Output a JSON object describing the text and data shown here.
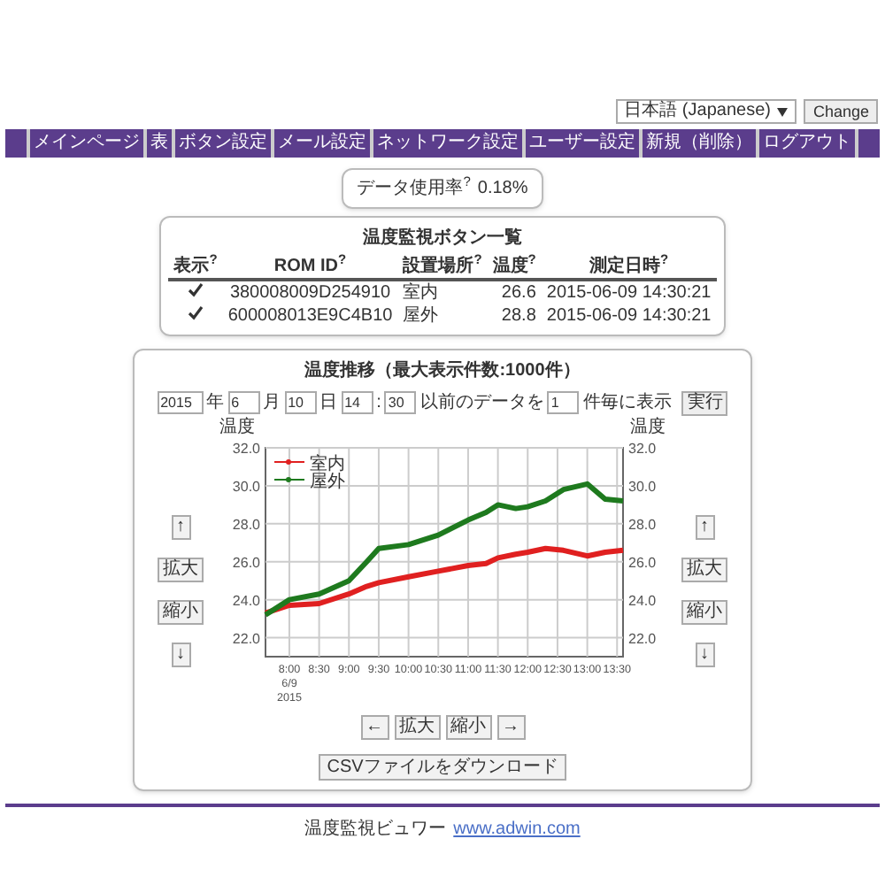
{
  "language": {
    "value": "日本語 (Japanese)",
    "button": "Change"
  },
  "nav": [
    "メインページ",
    "表",
    "ボタン設定",
    "メール設定",
    "ネットワーク設定",
    "ユーザー設定",
    "新規（削除）",
    "ログアウト"
  ],
  "usage": {
    "label": "データ使用率$^{?}$",
    "value": "0.18%"
  },
  "sensor_table": {
    "title": "温度監視ボタン一覧",
    "columns": [
      "表示$^{?}$",
      "ROM ID$^{?}$",
      "設置場所$^{?}$",
      "温度$^{?}$",
      "測定日時$^{?}$"
    ],
    "rows": [
      {
        "checked": true,
        "rom_id": "380008009D254910",
        "place": "室内",
        "temp": "26.6",
        "time": "2015-06-09 14:30:21"
      },
      {
        "checked": true,
        "rom_id": "600008013E9C4B10",
        "place": "屋外",
        "temp": "28.8",
        "time": "2015-06-09 14:30:21"
      }
    ]
  },
  "chart_panel": {
    "title": "温度推移（最大表示件数:1000件）",
    "form": [
      {
        "kind": "input",
        "value": "2015"
      },
      {
        "kind": "text",
        "text": "年"
      },
      {
        "kind": "input",
        "value": "6"
      },
      {
        "kind": "text",
        "text": "月"
      },
      {
        "kind": "input",
        "value": "10"
      },
      {
        "kind": "text",
        "text": "日"
      },
      {
        "kind": "input",
        "value": "14"
      },
      {
        "kind": "text",
        "text": ":"
      },
      {
        "kind": "input",
        "value": "30"
      },
      {
        "kind": "text",
        "text": "以前のデータを"
      },
      {
        "kind": "input",
        "value": "1"
      },
      {
        "kind": "text",
        "text": "件毎に表示"
      },
      {
        "kind": "button",
        "text": "実行"
      }
    ],
    "left_axis_label": "温度",
    "right_axis_label": "温度",
    "left_buttons": [
      "↑",
      "拡大",
      "縮小",
      "↓"
    ],
    "right_buttons": [
      "↑",
      "拡大",
      "縮小",
      "↓"
    ],
    "bottom_buttons": [
      "←",
      "拡大",
      "縮小",
      "→"
    ],
    "csv_button": "CSVファイルをダウンロード",
    "chart_data": {
      "type": "line",
      "x": [
        7.6,
        8,
        8.5,
        9,
        9.3,
        9.5,
        10,
        10.5,
        11,
        11.3,
        11.5,
        11.8,
        12,
        12.3,
        12.6,
        13,
        13.3,
        13.6
      ],
      "series": [
        {
          "name": "室内",
          "color": "#e02020",
          "values": [
            23.3,
            23.7,
            23.8,
            24.3,
            24.7,
            24.9,
            25.2,
            25.5,
            25.8,
            25.9,
            26.2,
            26.4,
            26.5,
            26.7,
            26.6,
            26.3,
            26.5,
            26.6
          ]
        },
        {
          "name": "屋外",
          "color": "#1e7a1e",
          "values": [
            23.2,
            24.0,
            24.3,
            25.0,
            26.0,
            26.7,
            26.9,
            27.4,
            28.2,
            28.6,
            29.0,
            28.8,
            28.9,
            29.2,
            29.8,
            30.1,
            29.3,
            29.2
          ]
        }
      ],
      "xlim": [
        7.6,
        13.6
      ],
      "ylim": [
        21,
        32
      ],
      "y2lim": [
        21,
        32
      ],
      "grid": true,
      "legend": true,
      "yticks": [
        {
          "value": 22,
          "label": "22.0"
        },
        {
          "value": 24,
          "label": "24.0"
        },
        {
          "value": 26,
          "label": "26.0"
        },
        {
          "value": 28,
          "label": "28.0"
        },
        {
          "value": 30,
          "label": "30.0"
        },
        {
          "value": 32,
          "label": "32.0"
        }
      ],
      "y2ticks": [
        {
          "value": 22,
          "label": "22.0"
        },
        {
          "value": 24,
          "label": "24.0"
        },
        {
          "value": 26,
          "label": "26.0"
        },
        {
          "value": 28,
          "label": "28.0"
        },
        {
          "value": 30,
          "label": "30.0"
        },
        {
          "value": 32,
          "label": "32.0"
        }
      ],
      "xticks": [
        {
          "value": 8,
          "label": "8:00\n6/9\n2015"
        },
        {
          "value": 8.5,
          "label": "8:30"
        },
        {
          "value": 9,
          "label": "9:00"
        },
        {
          "value": 9.5,
          "label": "9:30"
        },
        {
          "value": 10,
          "label": "10:00"
        },
        {
          "value": 10.5,
          "label": "10:30"
        },
        {
          "value": 11,
          "label": "11:00"
        },
        {
          "value": 11.5,
          "label": "11:30"
        },
        {
          "value": 12,
          "label": "12:00"
        },
        {
          "value": 12.5,
          "label": "12:30"
        },
        {
          "value": 13,
          "label": "13:00"
        },
        {
          "value": 13.5,
          "label": "13:30"
        }
      ]
    }
  },
  "footer": {
    "text": "温度監視ビュワー",
    "link": "www.adwin.com"
  }
}
